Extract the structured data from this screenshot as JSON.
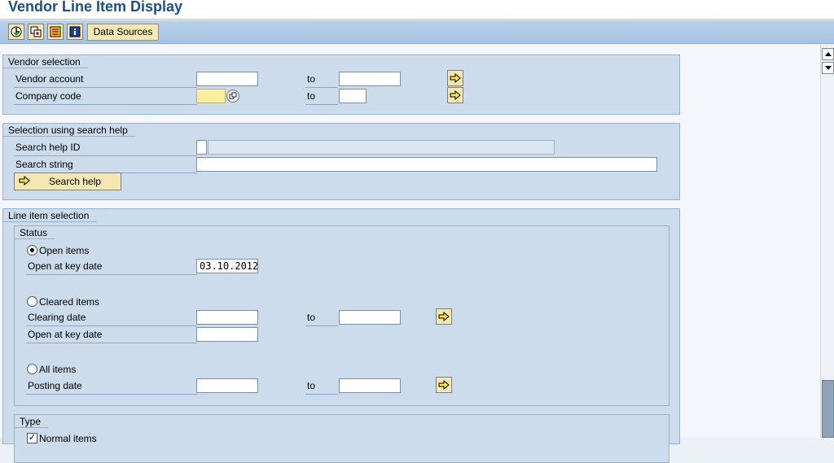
{
  "window": {
    "title": "Vendor Line Item Display"
  },
  "toolbar": {
    "data_sources_label": "Data Sources"
  },
  "vendor_selection": {
    "title": "Vendor selection",
    "vendor_account": {
      "label": "Vendor account",
      "from": "",
      "to_label": "to",
      "to": ""
    },
    "company_code": {
      "label": "Company code",
      "from": "",
      "to_label": "to",
      "to": ""
    }
  },
  "search_help": {
    "title": "Selection using search help",
    "id_label": "Search help ID",
    "id_value": "",
    "id_desc": "",
    "string_label": "Search string",
    "string_value": "",
    "button_label": "Search help"
  },
  "line_items": {
    "title": "Line item selection",
    "status": {
      "title": "Status",
      "open_items_label": "Open items",
      "open_key_date_label": "Open at key date",
      "open_key_date_value": "03.10.2012",
      "cleared_items_label": "Cleared items",
      "clearing_date_label": "Clearing date",
      "clearing_to_label": "to",
      "cleared_key_date_label": "Open at key date",
      "all_items_label": "All items",
      "posting_date_label": "Posting date",
      "posting_to_label": "to",
      "selected": "open"
    },
    "type": {
      "title": "Type",
      "normal_items_label": "Normal items",
      "normal_items_checked": true
    }
  }
}
